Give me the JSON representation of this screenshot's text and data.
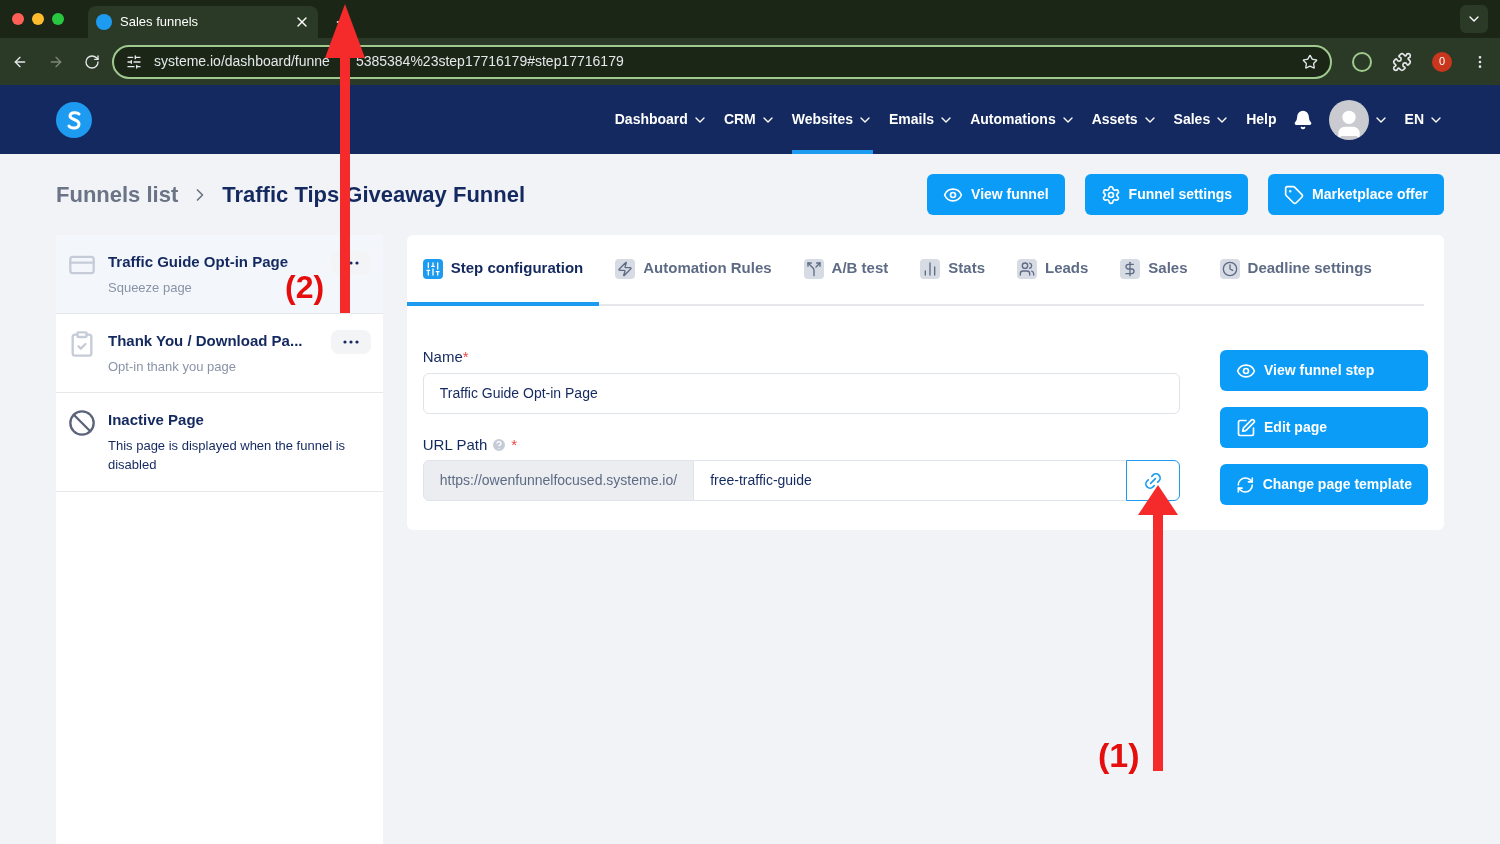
{
  "browser": {
    "tab_title": "Sales funnels",
    "url_parts": [
      "systeme.io/dashboard/funne",
      "5385384%23step17716179#step17716179"
    ],
    "extension_badge": "0"
  },
  "nav": {
    "items": [
      {
        "label": "Dashboard",
        "selected": false,
        "dropdown": true
      },
      {
        "label": "CRM",
        "selected": false,
        "dropdown": true
      },
      {
        "label": "Websites",
        "selected": true,
        "dropdown": true
      },
      {
        "label": "Emails",
        "selected": false,
        "dropdown": true
      },
      {
        "label": "Automations",
        "selected": false,
        "dropdown": true
      },
      {
        "label": "Assets",
        "selected": false,
        "dropdown": true
      },
      {
        "label": "Sales",
        "selected": false,
        "dropdown": true
      },
      {
        "label": "Help",
        "selected": false,
        "dropdown": false
      }
    ],
    "language": "EN"
  },
  "breadcrumb": {
    "parent": "Funnels list",
    "current": "Traffic Tips Giveaway Funnel"
  },
  "header_buttons": [
    {
      "kind": "eye",
      "label": "View funnel"
    },
    {
      "kind": "gear",
      "label": "Funnel settings"
    },
    {
      "kind": "tag",
      "label": "Marketplace offer"
    }
  ],
  "steps": [
    {
      "kind": "squeeze",
      "title": "Traffic Guide Opt-in Page",
      "subtitle": "Squeeze page",
      "selected": true
    },
    {
      "kind": "thanks",
      "title": "Thank You / Download Pa...",
      "subtitle": "Opt-in thank you page",
      "selected": false
    },
    {
      "kind": "inactive",
      "title": "Inactive Page",
      "subtitle": "This page is displayed when the funnel is disabled",
      "selected": false
    }
  ],
  "tabs": [
    {
      "kind": "sliders",
      "label": "Step configuration",
      "selected": true
    },
    {
      "kind": "bolt",
      "label": "Automation Rules",
      "selected": false
    },
    {
      "kind": "split",
      "label": "A/B test",
      "selected": false
    },
    {
      "kind": "chart",
      "label": "Stats",
      "selected": false
    },
    {
      "kind": "people",
      "label": "Leads",
      "selected": false
    },
    {
      "kind": "dollar",
      "label": "Sales",
      "selected": false
    },
    {
      "kind": "clock",
      "label": "Deadline settings",
      "selected": false
    }
  ],
  "form": {
    "name_label": "Name",
    "name_value": "Traffic Guide Opt-in Page",
    "url_label": "URL Path",
    "required_mark": "*",
    "url_prefix": "https://owenfunnelfocused.systeme.io/",
    "url_value": "free-traffic-guide"
  },
  "side_buttons": [
    {
      "kind": "eye",
      "label": "View funnel step"
    },
    {
      "kind": "edit",
      "label": "Edit page"
    },
    {
      "kind": "refresh",
      "label": "Change page template"
    }
  ],
  "annotations": [
    {
      "label": "(1)"
    },
    {
      "label": "(2)"
    }
  ]
}
